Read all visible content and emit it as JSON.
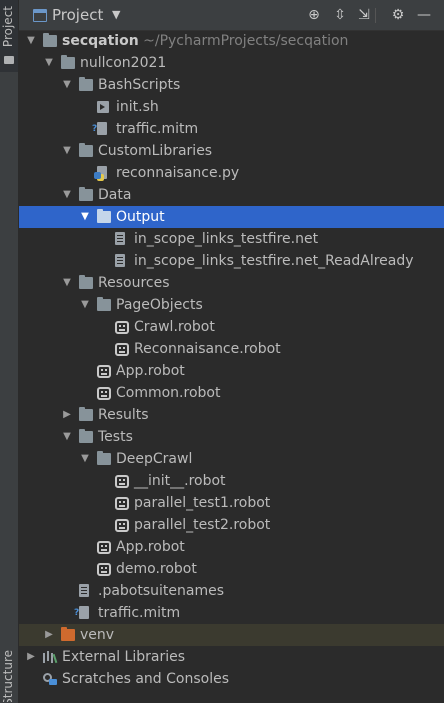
{
  "strip": {
    "project_label": "Project",
    "structure_label": "Structure"
  },
  "header": {
    "title": "Project",
    "caret": "▼",
    "locate_icon": "⊕",
    "expand_icon": "⇳",
    "collapse_icon": "⇲",
    "settings_icon": "⚙",
    "hide_icon": "—"
  },
  "tree": [
    {
      "label": "secqation",
      "path": " ~/PycharmProjects/secqation",
      "icon": "folder",
      "arrow": "▼",
      "depth": 0,
      "bold": true
    },
    {
      "label": "nullcon2021",
      "icon": "folder",
      "arrow": "▼",
      "depth": 1
    },
    {
      "label": "BashScripts",
      "icon": "folder",
      "arrow": "▼",
      "depth": 2
    },
    {
      "label": "init.sh",
      "icon": "shell",
      "arrow": "",
      "depth": 3
    },
    {
      "label": "traffic.mitm",
      "icon": "mitm",
      "arrow": "",
      "depth": 3
    },
    {
      "label": "CustomLibraries",
      "icon": "folder",
      "arrow": "▼",
      "depth": 2
    },
    {
      "label": "reconnaisance.py",
      "icon": "pyfile",
      "arrow": "",
      "depth": 3
    },
    {
      "label": "Data",
      "icon": "folder",
      "arrow": "▼",
      "depth": 2
    },
    {
      "label": "Output",
      "icon": "folder",
      "arrow": "▼",
      "depth": 3,
      "selected": true
    },
    {
      "label": "in_scope_links_testfire.net",
      "icon": "filedoc",
      "arrow": "",
      "depth": 4
    },
    {
      "label": "in_scope_links_testfire.net_ReadAlready",
      "icon": "filedoc",
      "arrow": "",
      "depth": 4
    },
    {
      "label": "Resources",
      "icon": "folder",
      "arrow": "▼",
      "depth": 2
    },
    {
      "label": "PageObjects",
      "icon": "folder",
      "arrow": "▼",
      "depth": 3
    },
    {
      "label": "Crawl.robot",
      "icon": "robot",
      "arrow": "",
      "depth": 4
    },
    {
      "label": "Reconnaisance.robot",
      "icon": "robot",
      "arrow": "",
      "depth": 4
    },
    {
      "label": "App.robot",
      "icon": "robot",
      "arrow": "",
      "depth": 3
    },
    {
      "label": "Common.robot",
      "icon": "robot",
      "arrow": "",
      "depth": 3
    },
    {
      "label": "Results",
      "icon": "folder",
      "arrow": "▶",
      "depth": 2
    },
    {
      "label": "Tests",
      "icon": "folder",
      "arrow": "▼",
      "depth": 2
    },
    {
      "label": "DeepCrawl",
      "icon": "folder",
      "arrow": "▼",
      "depth": 3
    },
    {
      "label": "__init__.robot",
      "icon": "robot",
      "arrow": "",
      "depth": 4
    },
    {
      "label": "parallel_test1.robot",
      "icon": "robot",
      "arrow": "",
      "depth": 4
    },
    {
      "label": "parallel_test2.robot",
      "icon": "robot",
      "arrow": "",
      "depth": 4
    },
    {
      "label": "App.robot",
      "icon": "robot",
      "arrow": "",
      "depth": 3
    },
    {
      "label": "demo.robot",
      "icon": "robot",
      "arrow": "",
      "depth": 3
    },
    {
      "label": ".pabotsuitenames",
      "icon": "filedoc",
      "arrow": "",
      "depth": 2
    },
    {
      "label": "traffic.mitm",
      "icon": "mitm",
      "arrow": "",
      "depth": 2
    },
    {
      "label": "venv",
      "icon": "folder-excluded",
      "arrow": "▶",
      "depth": 1,
      "excluded": true
    },
    {
      "label": "External Libraries",
      "icon": "libs",
      "arrow": "▶",
      "depth": 0
    },
    {
      "label": "Scratches and Consoles",
      "icon": "scratch",
      "arrow": "",
      "depth": 0
    }
  ]
}
